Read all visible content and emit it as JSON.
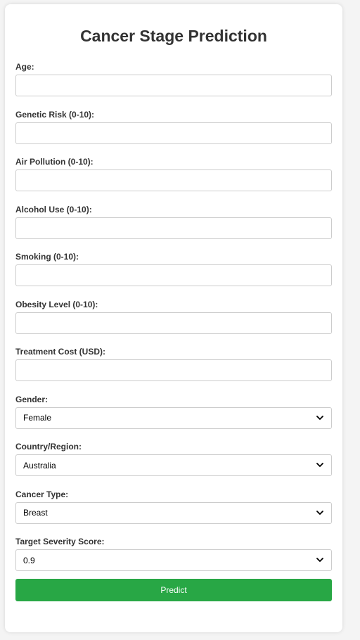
{
  "page": {
    "title": "Cancer Stage Prediction"
  },
  "fields": {
    "age": {
      "label": "Age:",
      "value": ""
    },
    "genetic_risk": {
      "label": "Genetic Risk (0-10):",
      "value": ""
    },
    "air_pollution": {
      "label": "Air Pollution (0-10):",
      "value": ""
    },
    "alcohol_use": {
      "label": "Alcohol Use (0-10):",
      "value": ""
    },
    "smoking": {
      "label": "Smoking (0-10):",
      "value": ""
    },
    "obesity_level": {
      "label": "Obesity Level (0-10):",
      "value": ""
    },
    "treatment_cost": {
      "label": "Treatment Cost (USD):",
      "value": ""
    },
    "gender": {
      "label": "Gender:",
      "selected": "Female"
    },
    "country": {
      "label": "Country/Region:",
      "selected": "Australia"
    },
    "cancer_type": {
      "label": "Cancer Type:",
      "selected": "Breast"
    },
    "severity": {
      "label": "Target Severity Score:",
      "selected": "0.9"
    }
  },
  "actions": {
    "predict_label": "Predict"
  },
  "colors": {
    "accent": "#28a745",
    "text": "#333333",
    "border": "#cccccc",
    "background": "#f4f4f4"
  },
  "icons": {
    "select_arrow": "chevron-down-icon"
  }
}
